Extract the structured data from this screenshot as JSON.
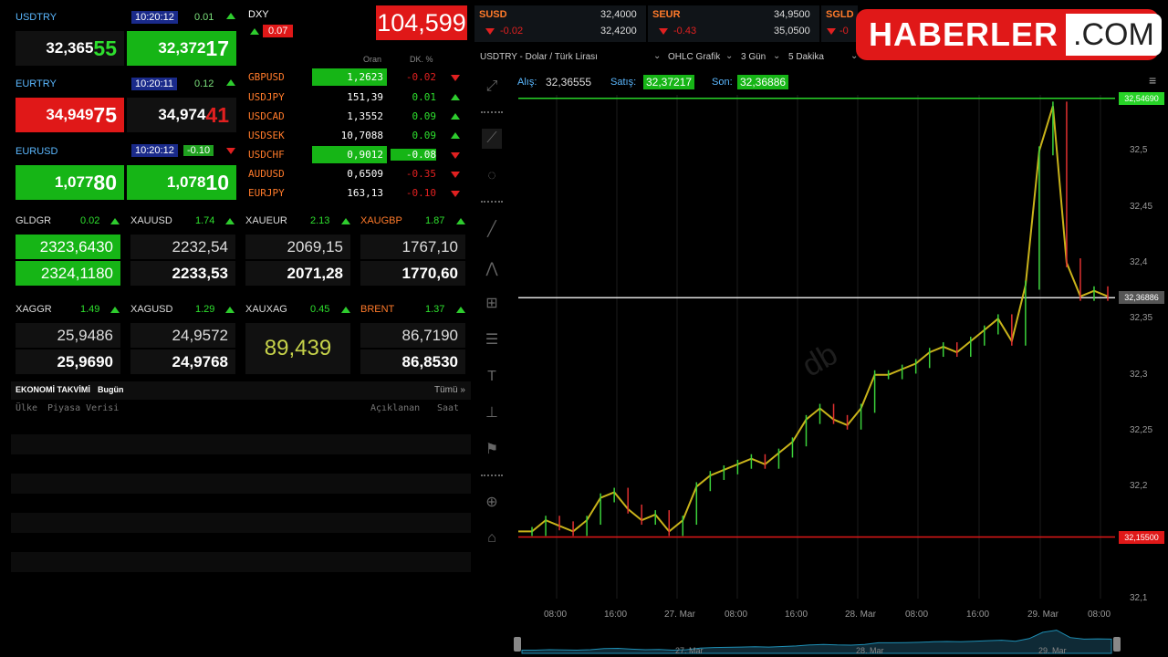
{
  "quotes": [
    {
      "symbol": "USDTRY",
      "time": "10:20:12",
      "change": "0.01",
      "bid_main": "32,365",
      "bid_tail": "55",
      "ask_main": "32,372",
      "ask_tail": "17"
    },
    {
      "symbol": "EURTRY",
      "time": "10:20:11",
      "change": "0.12",
      "bid_main": "34,949",
      "bid_tail": "75",
      "ask_main": "34,974",
      "ask_tail": "41"
    },
    {
      "symbol": "EURUSD",
      "time": "10:20:12",
      "change": "-0.10",
      "bid_main": "1,077",
      "bid_tail": "80",
      "ask_main": "1,078",
      "ask_tail": "10"
    }
  ],
  "dxy": {
    "label": "DXY",
    "change": "0.07",
    "value": "104,599"
  },
  "fx_table": {
    "col_price": "Oran",
    "col_change": "DK. %",
    "rows": [
      {
        "symbol": "GBPUSD",
        "price": "1,2623",
        "change": "-0.02"
      },
      {
        "symbol": "USDJPY",
        "price": "151,39",
        "change": "0.01"
      },
      {
        "symbol": "USDCAD",
        "price": "1,3552",
        "change": "0.09"
      },
      {
        "symbol": "USDSEK",
        "price": "10,7088",
        "change": "0.09"
      },
      {
        "symbol": "USDCHF",
        "price": "0,9012",
        "change": "-0.08"
      },
      {
        "symbol": "AUDUSD",
        "price": "0,6509",
        "change": "-0.35"
      },
      {
        "symbol": "EURJPY",
        "price": "163,13",
        "change": "-0.10"
      }
    ]
  },
  "metals": [
    {
      "name": "GLDGR",
      "change": "0.02",
      "bid": "2323,6430",
      "ask": "2324,1180"
    },
    {
      "name": "XAUUSD",
      "change": "1.74",
      "bid": "2232,54",
      "ask": "2233,53"
    },
    {
      "name": "XAUEUR",
      "change": "2.13",
      "bid": "2069,15",
      "ask": "2071,28"
    },
    {
      "name": "XAUGBP",
      "change": "1.87",
      "bid": "1767,10",
      "ask": "1770,60"
    },
    {
      "name": "XAGGR",
      "change": "1.49",
      "bid": "25,9486",
      "ask": "25,9690"
    },
    {
      "name": "XAGUSD",
      "change": "1.29",
      "bid": "24,9572",
      "ask": "24,9768"
    },
    {
      "name": "XAUXAG",
      "change": "0.45",
      "value": "89,439"
    },
    {
      "name": "BRENT",
      "change": "1.37",
      "bid": "86,7190",
      "ask": "86,8530"
    }
  ],
  "calendar": {
    "title": "EKONOMİ TAKVİMİ",
    "scope": "Bugün",
    "all_link": "Tümü »",
    "col_country": "Ülke",
    "col_data": "Piyasa Verisi",
    "col_announced": "Açıklanan",
    "col_time": "Saat"
  },
  "top_strip": [
    {
      "symbol": "SUSD",
      "change": "-0.02",
      "bid": "32,4000",
      "ask": "32,4200"
    },
    {
      "symbol": "SEUR",
      "change": "-0.43",
      "bid": "34,9500",
      "ask": "35,0500"
    },
    {
      "symbol": "SGLD",
      "change": "-0"
    }
  ],
  "brand": {
    "name": "HABERLER",
    "suffix": ".COM"
  },
  "chart_toolbar": {
    "instrument": "USDTRY - Dolar / Türk Lirası",
    "chart_type": "OHLC Grafik",
    "range": "3 Gün",
    "interval": "5 Dakika"
  },
  "chart_quote": {
    "bid_label": "Alış:",
    "bid": "32,36555",
    "ask_label": "Satış:",
    "ask": "32,37217",
    "last_label": "Son:",
    "last": "32,36886"
  },
  "chart_data": {
    "type": "line",
    "title": "",
    "x": [
      "08:00",
      "16:00",
      "27. Mar",
      "08:00",
      "16:00",
      "28. Mar",
      "08:00",
      "16:00",
      "29. Mar",
      "08:00"
    ],
    "y_ticks": [
      "32,5",
      "32,45",
      "32,4",
      "32,35",
      "32,3",
      "32,25",
      "32,2",
      "32,1"
    ],
    "ylim": [
      32.1,
      32.55
    ],
    "series": [
      {
        "values": [
          32.16,
          32.16,
          32.17,
          32.165,
          32.16,
          32.17,
          32.19,
          32.195,
          32.18,
          32.17,
          32.175,
          32.16,
          32.17,
          32.2,
          32.21,
          32.215,
          32.22,
          32.225,
          32.22,
          32.23,
          32.24,
          32.26,
          32.27,
          32.26,
          32.255,
          32.27,
          32.3,
          32.3,
          32.305,
          32.31,
          32.32,
          32.325,
          32.32,
          32.33,
          32.34,
          32.35,
          32.33,
          32.38,
          32.5,
          32.54,
          32.4,
          32.37,
          32.375,
          32.37
        ]
      }
    ],
    "lines": [
      {
        "label": "32,54690",
        "value": 32.5469,
        "color": "#27d327"
      },
      {
        "label": "32,36886",
        "value": 32.36886,
        "color": "#e0e0e0"
      },
      {
        "label": "32,15500",
        "value": 32.155,
        "color": "#e01818"
      }
    ],
    "navigator_labels": [
      "27. Mar",
      "28. Mar",
      "29. Mar"
    ]
  }
}
